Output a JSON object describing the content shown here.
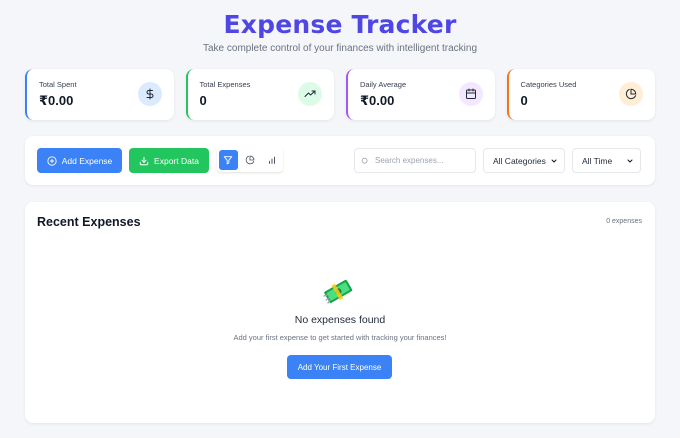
{
  "header": {
    "title": "Expense Tracker",
    "subtitle": "Take complete control of your finances with intelligent tracking"
  },
  "stats": [
    {
      "label": "Total Spent",
      "value": "₹0.00",
      "icon": "dollar-icon",
      "accent": "#3b82f6"
    },
    {
      "label": "Total Expenses",
      "value": "0",
      "icon": "trending-up-icon",
      "accent": "#22c55e"
    },
    {
      "label": "Daily Average",
      "value": "₹0.00",
      "icon": "calendar-icon",
      "accent": "#a855f7"
    },
    {
      "label": "Categories Used",
      "value": "0",
      "icon": "pie-chart-icon",
      "accent": "#f97316"
    }
  ],
  "toolbar": {
    "add_label": "Add Expense",
    "export_label": "Export Data",
    "search_placeholder": "Search expenses...",
    "category_selected": "All Categories",
    "time_selected": "All Time",
    "view_icons": [
      "filter-icon",
      "pie-chart-icon",
      "bar-chart-icon"
    ]
  },
  "recent": {
    "title": "Recent Expenses",
    "count": "0 expenses",
    "empty_icon": "money-icon",
    "empty_title": "No expenses found",
    "empty_subtitle": "Add your first expense to get started with tracking your finances!",
    "cta_label": "Add Your First Expense"
  },
  "colors": {
    "primary": "#3b82f6",
    "success": "#22c55e",
    "title": "#4f46e5"
  }
}
